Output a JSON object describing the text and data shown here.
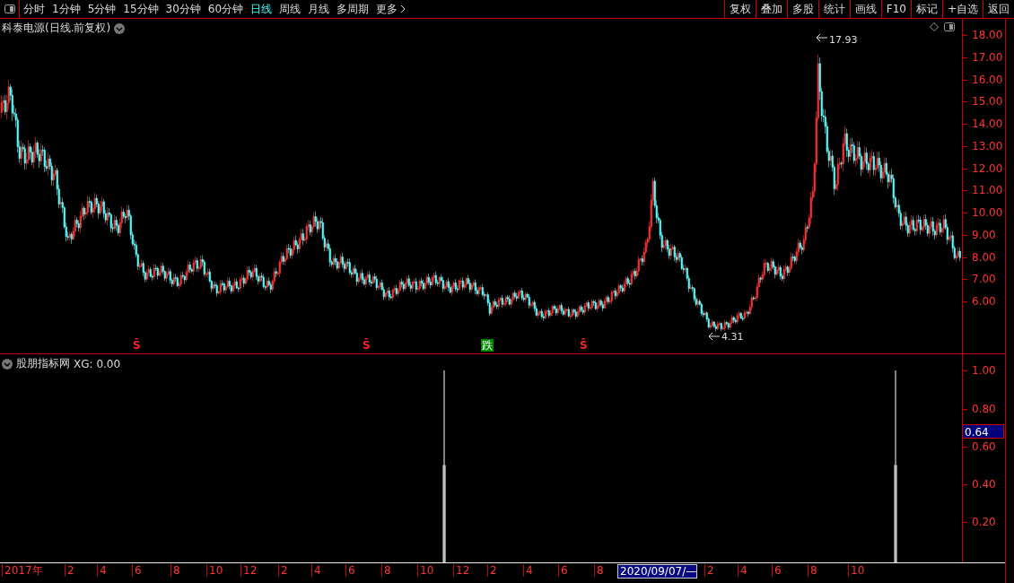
{
  "toolbar": {
    "periods": [
      {
        "label": "分时",
        "selected": false
      },
      {
        "label": "1分钟",
        "selected": false
      },
      {
        "label": "5分钟",
        "selected": false
      },
      {
        "label": "15分钟",
        "selected": false
      },
      {
        "label": "30分钟",
        "selected": false
      },
      {
        "label": "60分钟",
        "selected": false
      },
      {
        "label": "日线",
        "selected": true
      },
      {
        "label": "周线",
        "selected": false
      },
      {
        "label": "月线",
        "selected": false
      },
      {
        "label": "多周期",
        "selected": false
      }
    ],
    "more": "更多",
    "actions": [
      "复权",
      "叠加",
      "多股",
      "统计",
      "画线",
      "F10",
      "标记",
      "+自选",
      "返回"
    ]
  },
  "price_pane": {
    "title": "科泰电源(日线.前复权)",
    "y_labels": [
      "18.00",
      "17.00",
      "16.00",
      "15.00",
      "14.00",
      "13.00",
      "12.00",
      "11.00",
      "10.00",
      "9.00",
      "8.00",
      "7.00",
      "6.00"
    ],
    "high_label": "17.93",
    "low_label": "4.31",
    "markers": [
      {
        "kind": "signal",
        "label": "Ŝ"
      },
      {
        "kind": "signal",
        "label": "Ŝ"
      },
      {
        "kind": "fall",
        "label": "跌"
      },
      {
        "kind": "signal",
        "label": "Ŝ"
      }
    ]
  },
  "indicator_pane": {
    "name": "股朋指标网",
    "value": "XG: 0.00",
    "y_labels": [
      "1.00",
      "0.80",
      "0.60",
      "0.40",
      "0.20"
    ],
    "cursor_value": "0.64"
  },
  "date_axis": [
    {
      "label": "2017年",
      "selected": false
    },
    {
      "label": "2",
      "selected": false
    },
    {
      "label": "4",
      "selected": false
    },
    {
      "label": "6",
      "selected": false
    },
    {
      "label": "8",
      "selected": false
    },
    {
      "label": "10",
      "selected": false
    },
    {
      "label": "12",
      "selected": false
    },
    {
      "label": "2",
      "selected": false
    },
    {
      "label": "4",
      "selected": false
    },
    {
      "label": "6",
      "selected": false
    },
    {
      "label": "8",
      "selected": false
    },
    {
      "label": "10",
      "selected": false
    },
    {
      "label": "12",
      "selected": false
    },
    {
      "label": "2",
      "selected": false
    },
    {
      "label": "4",
      "selected": false
    },
    {
      "label": "6",
      "selected": false
    },
    {
      "label": "8",
      "selected": false
    },
    {
      "label": "2020/09/07/—",
      "selected": true
    },
    {
      "label": "2",
      "selected": false
    },
    {
      "label": "4",
      "selected": false
    },
    {
      "label": "6",
      "selected": false
    },
    {
      "label": "8",
      "selected": false
    },
    {
      "label": "10",
      "selected": false
    }
  ]
}
